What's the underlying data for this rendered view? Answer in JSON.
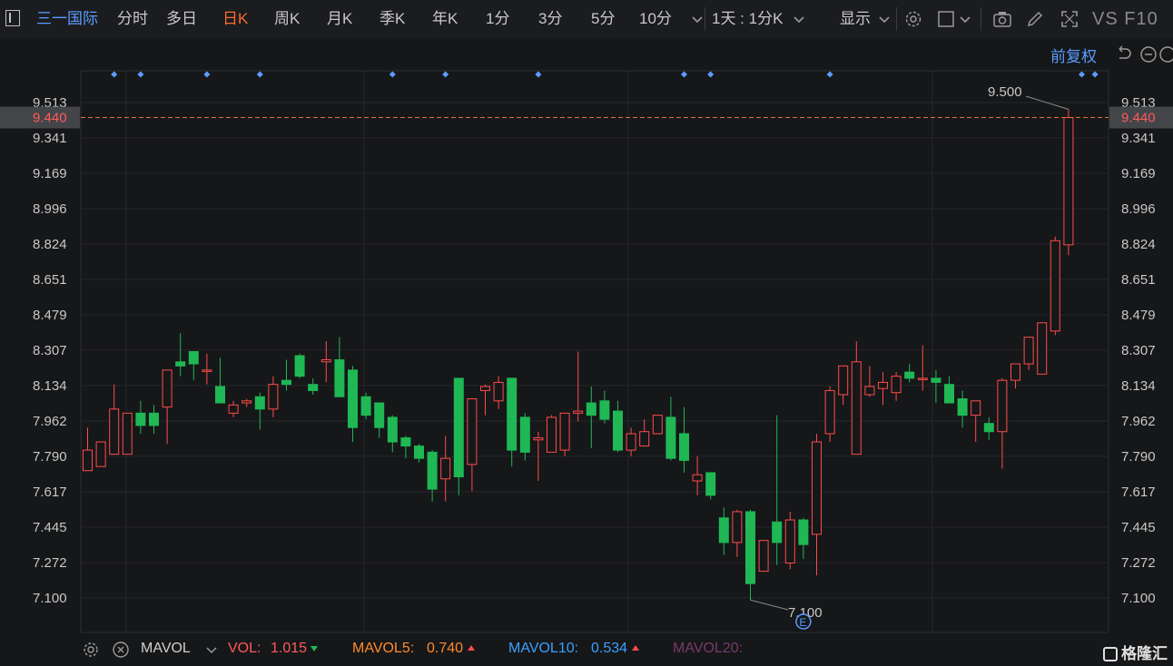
{
  "toolbar": {
    "stock_name": "三一国际",
    "periods": [
      "分时",
      "多日",
      "日K",
      "周K",
      "月K",
      "季K",
      "年K",
      "1分",
      "3分",
      "5分",
      "10分"
    ],
    "active_period": "日K",
    "interval_select": "1天 : 1分K",
    "display_label": "显示",
    "vs_f10": "VS F10",
    "adjust_label": "前复权"
  },
  "colors": {
    "up": "#ff4b4b",
    "down": "#1fb854",
    "accent": "#5b9cff",
    "active": "#ff6a2a",
    "price_line": "#e07040",
    "vol": "#ff5a5a",
    "mavol5": "#ff8a2a",
    "mavol10": "#3aa0ff",
    "mavol20": "#7a3a6a"
  },
  "price_line": {
    "value": "9.440"
  },
  "annotations": {
    "high": "9.500",
    "low": "7.100",
    "event_marker": "E"
  },
  "indicator": {
    "name": "MAVOL",
    "vol_label": "VOL:",
    "vol_value": "1.015",
    "mavol5_label": "MAVOL5:",
    "mavol5_value": "0.740",
    "mavol10_label": "MAVOL10:",
    "mavol10_value": "0.534",
    "mavol20_label": "MAVOL20:"
  },
  "brand": "格隆汇",
  "chart_data": {
    "type": "candlestick",
    "y_ticks": [
      "9.513",
      "9.341",
      "9.169",
      "8.996",
      "8.824",
      "8.651",
      "8.479",
      "8.307",
      "8.134",
      "7.962",
      "7.790",
      "7.617",
      "7.445",
      "7.272",
      "7.100"
    ],
    "ylim": [
      7.03,
      9.6
    ],
    "grid": true,
    "dividend_markers": [
      2,
      4,
      9,
      13,
      23,
      27,
      34,
      45,
      47,
      56,
      75,
      76
    ],
    "candles": [
      {
        "o": 7.72,
        "h": 7.93,
        "l": 7.72,
        "c": 7.82
      },
      {
        "o": 7.74,
        "h": 7.86,
        "l": 7.74,
        "c": 7.86
      },
      {
        "o": 7.8,
        "h": 8.14,
        "l": 7.8,
        "c": 8.02
      },
      {
        "o": 7.8,
        "h": 8.0,
        "l": 7.8,
        "c": 8.0
      },
      {
        "o": 8.0,
        "h": 8.06,
        "l": 7.9,
        "c": 7.94
      },
      {
        "o": 8.0,
        "h": 8.04,
        "l": 7.9,
        "c": 7.94
      },
      {
        "o": 8.03,
        "h": 8.21,
        "l": 7.85,
        "c": 8.21
      },
      {
        "o": 8.25,
        "h": 8.39,
        "l": 8.18,
        "c": 8.23
      },
      {
        "o": 8.3,
        "h": 8.3,
        "l": 8.16,
        "c": 8.24
      },
      {
        "o": 8.21,
        "h": 8.29,
        "l": 8.14,
        "c": 8.21
      },
      {
        "o": 8.13,
        "h": 8.27,
        "l": 8.05,
        "c": 8.05
      },
      {
        "o": 8.0,
        "h": 8.06,
        "l": 7.98,
        "c": 8.04
      },
      {
        "o": 8.05,
        "h": 8.07,
        "l": 8.03,
        "c": 8.06
      },
      {
        "o": 8.08,
        "h": 8.1,
        "l": 7.92,
        "c": 8.02
      },
      {
        "o": 8.02,
        "h": 8.18,
        "l": 7.98,
        "c": 8.14
      },
      {
        "o": 8.16,
        "h": 8.26,
        "l": 8.11,
        "c": 8.14
      },
      {
        "o": 8.28,
        "h": 8.29,
        "l": 8.17,
        "c": 8.18
      },
      {
        "o": 8.14,
        "h": 8.17,
        "l": 8.09,
        "c": 8.11
      },
      {
        "o": 8.25,
        "h": 8.35,
        "l": 8.15,
        "c": 8.26
      },
      {
        "o": 8.26,
        "h": 8.37,
        "l": 8.08,
        "c": 8.08
      },
      {
        "o": 8.21,
        "h": 8.23,
        "l": 7.86,
        "c": 7.93
      },
      {
        "o": 8.08,
        "h": 8.1,
        "l": 7.97,
        "c": 7.99
      },
      {
        "o": 8.05,
        "h": 8.05,
        "l": 7.88,
        "c": 7.93
      },
      {
        "o": 7.98,
        "h": 7.99,
        "l": 7.81,
        "c": 7.86
      },
      {
        "o": 7.88,
        "h": 7.89,
        "l": 7.78,
        "c": 7.84
      },
      {
        "o": 7.84,
        "h": 7.85,
        "l": 7.76,
        "c": 7.78
      },
      {
        "o": 7.81,
        "h": 7.82,
        "l": 7.57,
        "c": 7.63
      },
      {
        "o": 7.68,
        "h": 7.89,
        "l": 7.57,
        "c": 7.78
      },
      {
        "o": 8.17,
        "h": 8.17,
        "l": 7.6,
        "c": 7.69
      },
      {
        "o": 7.75,
        "h": 8.06,
        "l": 7.62,
        "c": 8.07
      },
      {
        "o": 8.11,
        "h": 8.14,
        "l": 7.99,
        "c": 8.13
      },
      {
        "o": 8.06,
        "h": 8.18,
        "l": 8.02,
        "c": 8.15
      },
      {
        "o": 8.17,
        "h": 8.17,
        "l": 7.74,
        "c": 7.82
      },
      {
        "o": 7.98,
        "h": 8.0,
        "l": 7.77,
        "c": 7.81
      },
      {
        "o": 7.87,
        "h": 7.91,
        "l": 7.67,
        "c": 7.88
      },
      {
        "o": 7.81,
        "h": 7.99,
        "l": 7.81,
        "c": 7.98
      },
      {
        "o": 7.82,
        "h": 7.98,
        "l": 7.79,
        "c": 8.0
      },
      {
        "o": 8.0,
        "h": 8.3,
        "l": 7.96,
        "c": 8.01
      },
      {
        "o": 8.05,
        "h": 8.13,
        "l": 7.83,
        "c": 7.99
      },
      {
        "o": 8.06,
        "h": 8.11,
        "l": 7.95,
        "c": 7.97
      },
      {
        "o": 8.01,
        "h": 8.06,
        "l": 7.81,
        "c": 7.82
      },
      {
        "o": 7.82,
        "h": 7.93,
        "l": 7.79,
        "c": 7.9
      },
      {
        "o": 7.84,
        "h": 7.97,
        "l": 7.84,
        "c": 7.91
      },
      {
        "o": 7.9,
        "h": 7.99,
        "l": 7.9,
        "c": 7.99
      },
      {
        "o": 7.98,
        "h": 8.08,
        "l": 7.77,
        "c": 7.78
      },
      {
        "o": 7.9,
        "h": 8.03,
        "l": 7.71,
        "c": 7.77
      },
      {
        "o": 7.67,
        "h": 7.79,
        "l": 7.6,
        "c": 7.7
      },
      {
        "o": 7.71,
        "h": 7.71,
        "l": 7.58,
        "c": 7.6
      },
      {
        "o": 7.49,
        "h": 7.54,
        "l": 7.31,
        "c": 7.37
      },
      {
        "o": 7.37,
        "h": 7.53,
        "l": 7.3,
        "c": 7.52
      },
      {
        "o": 7.52,
        "h": 7.53,
        "l": 7.09,
        "c": 7.17
      },
      {
        "o": 7.23,
        "h": 7.38,
        "l": 7.23,
        "c": 7.38
      },
      {
        "o": 7.47,
        "h": 7.99,
        "l": 7.26,
        "c": 7.37
      },
      {
        "o": 7.27,
        "h": 7.52,
        "l": 7.24,
        "c": 7.48
      },
      {
        "o": 7.48,
        "h": 7.49,
        "l": 7.29,
        "c": 7.36
      },
      {
        "o": 7.41,
        "h": 7.9,
        "l": 7.21,
        "c": 7.86
      },
      {
        "o": 7.9,
        "h": 8.13,
        "l": 7.86,
        "c": 8.11
      },
      {
        "o": 8.09,
        "h": 8.23,
        "l": 8.04,
        "c": 8.23
      },
      {
        "o": 7.8,
        "h": 8.35,
        "l": 7.8,
        "c": 8.25
      },
      {
        "o": 8.09,
        "h": 8.23,
        "l": 8.08,
        "c": 8.13
      },
      {
        "o": 8.12,
        "h": 8.2,
        "l": 8.04,
        "c": 8.15
      },
      {
        "o": 8.1,
        "h": 8.2,
        "l": 8.06,
        "c": 8.18
      },
      {
        "o": 8.2,
        "h": 8.24,
        "l": 8.15,
        "c": 8.17
      },
      {
        "o": 8.17,
        "h": 8.33,
        "l": 8.11,
        "c": 8.17
      },
      {
        "o": 8.17,
        "h": 8.21,
        "l": 8.05,
        "c": 8.15
      },
      {
        "o": 8.14,
        "h": 8.18,
        "l": 8.05,
        "c": 8.05
      },
      {
        "o": 8.07,
        "h": 8.11,
        "l": 7.93,
        "c": 7.99
      },
      {
        "o": 7.99,
        "h": 8.06,
        "l": 7.86,
        "c": 8.06
      },
      {
        "o": 7.95,
        "h": 7.98,
        "l": 7.87,
        "c": 7.91
      },
      {
        "o": 7.91,
        "h": 8.17,
        "l": 7.73,
        "c": 8.16
      },
      {
        "o": 8.16,
        "h": 8.24,
        "l": 8.12,
        "c": 8.24
      },
      {
        "o": 8.24,
        "h": 8.29,
        "l": 8.21,
        "c": 8.37
      },
      {
        "o": 8.19,
        "h": 8.44,
        "l": 8.19,
        "c": 8.44
      },
      {
        "o": 8.4,
        "h": 8.86,
        "l": 8.38,
        "c": 8.84
      },
      {
        "o": 8.82,
        "h": 9.48,
        "l": 8.77,
        "c": 9.44
      }
    ]
  }
}
